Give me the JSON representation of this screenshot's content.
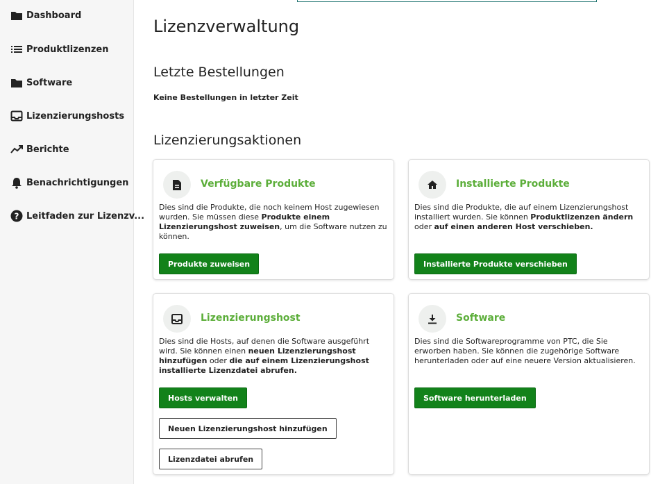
{
  "sidebar": {
    "items": [
      {
        "label": "Dashboard",
        "icon": "folder-icon"
      },
      {
        "label": "Produktlizenzen",
        "icon": "list-icon"
      },
      {
        "label": "Software",
        "icon": "folder-icon"
      },
      {
        "label": "Lizenzierungshosts",
        "icon": "inbox-icon"
      },
      {
        "label": "Berichte",
        "icon": "trending-up-icon"
      },
      {
        "label": "Benachrichtigungen",
        "icon": "bell-icon"
      },
      {
        "label": "Leitfaden zur Lizenzv...",
        "icon": "help-circle-icon"
      }
    ]
  },
  "main": {
    "title": "Lizenzverwaltung",
    "recent_orders": {
      "title": "Letzte Bestellungen",
      "empty_text": "Keine Bestellungen in letzter Zeit"
    },
    "actions": {
      "title": "Lizenzierungsaktionen",
      "cards": [
        {
          "title": "Verfügbare Produkte",
          "icon": "document-icon",
          "text": [
            {
              "t": "Dies sind die Produkte, die noch keinem Host zugewiesen wurden. Sie müssen diese ",
              "b": false
            },
            {
              "t": "Produkte einem Lizenzierungshost zuweisen",
              "b": true
            },
            {
              "t": ", um die Software nutzen zu können.",
              "b": false
            }
          ],
          "buttons": [
            {
              "label": "Produkte zuweisen",
              "style": "primary"
            }
          ]
        },
        {
          "title": "Installierte Produkte",
          "icon": "home-icon",
          "text": [
            {
              "t": "Dies sind die Produkte, die auf einem Lizenzierungshost installiert wurden. Sie können ",
              "b": false
            },
            {
              "t": "Produktlizenzen ändern",
              "b": true
            },
            {
              "t": " oder ",
              "b": false
            },
            {
              "t": "auf einen anderen Host verschieben.",
              "b": true
            }
          ],
          "buttons": [
            {
              "label": "Installierte Produkte verschieben",
              "style": "primary"
            }
          ]
        },
        {
          "title": "Lizenzierungshost",
          "icon": "inbox-icon",
          "text": [
            {
              "t": "Dies sind die Hosts, auf denen die Software ausgeführt wird. Sie können einen ",
              "b": false
            },
            {
              "t": "neuen Lizenzierungshost hinzufügen",
              "b": true
            },
            {
              "t": " oder ",
              "b": false
            },
            {
              "t": "die auf einem Lizenzierungshost installierte Lizenzdatei abrufen.",
              "b": true
            }
          ],
          "buttons": [
            {
              "label": "Hosts verwalten",
              "style": "primary"
            },
            {
              "label": "Neuen Lizenzierungshost hinzufügen",
              "style": "outline"
            },
            {
              "label": "Lizenzdatei abrufen",
              "style": "outline"
            }
          ]
        },
        {
          "title": "Software",
          "icon": "download-icon",
          "text": [
            {
              "t": "Dies sind die Softwareprogramme von PTC, die Sie erworben haben. Sie können die zugehörige Software herunterladen oder auf eine neuere Version aktualisieren.",
              "b": false
            }
          ],
          "buttons": [
            {
              "label": "Software herunterladen",
              "style": "primary"
            }
          ]
        }
      ]
    }
  },
  "colors": {
    "accent_green": "#5cae3a",
    "button_green": "#12821a",
    "sidebar_bg": "#f6f6f6"
  }
}
